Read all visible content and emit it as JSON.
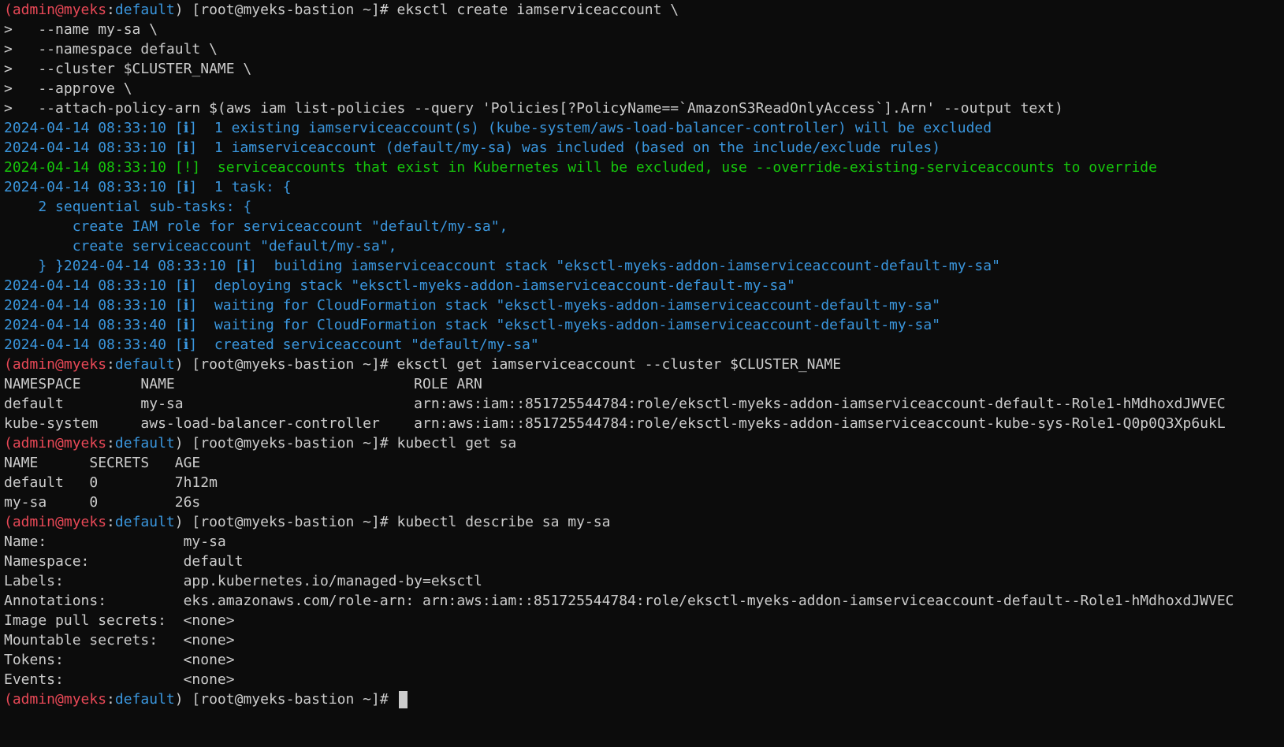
{
  "lines": [
    [
      [
        "red",
        "(admin@myeks"
      ],
      [
        "white",
        ":"
      ],
      [
        "blue",
        "default"
      ],
      [
        "white",
        ") [root@myeks-bastion ~]# eksctl create iamserviceaccount \\"
      ]
    ],
    [
      [
        "white",
        ">   --name my-sa \\"
      ]
    ],
    [
      [
        "white",
        ">   --namespace default \\"
      ]
    ],
    [
      [
        "white",
        ">   --cluster $CLUSTER_NAME \\"
      ]
    ],
    [
      [
        "white",
        ">   --approve \\"
      ]
    ],
    [
      [
        "white",
        ">   --attach-policy-arn $(aws iam list-policies --query 'Policies[?PolicyName==`AmazonS3ReadOnlyAccess`].Arn' --output text)"
      ]
    ],
    [
      [
        "blue",
        "2024-04-14 08:33:10 [ℹ]  1 existing iamserviceaccount(s) (kube-system/aws-load-balancer-controller) will be excluded"
      ]
    ],
    [
      [
        "blue",
        "2024-04-14 08:33:10 [ℹ]  1 iamserviceaccount (default/my-sa) was included (based on the include/exclude rules)"
      ]
    ],
    [
      [
        "green",
        "2024-04-14 08:33:10 [!]  serviceaccounts that exist in Kubernetes will be excluded, use --override-existing-serviceaccounts to override"
      ]
    ],
    [
      [
        "blue",
        "2024-04-14 08:33:10 [ℹ]  1 task: {"
      ]
    ],
    [
      [
        "blue",
        "    2 sequential sub-tasks: {"
      ]
    ],
    [
      [
        "blue",
        "        create IAM role for serviceaccount \"default/my-sa\","
      ]
    ],
    [
      [
        "blue",
        "        create serviceaccount \"default/my-sa\","
      ]
    ],
    [
      [
        "blue",
        "    } }2024-04-14 08:33:10 [ℹ]  building iamserviceaccount stack \"eksctl-myeks-addon-iamserviceaccount-default-my-sa\""
      ]
    ],
    [
      [
        "blue",
        "2024-04-14 08:33:10 [ℹ]  deploying stack \"eksctl-myeks-addon-iamserviceaccount-default-my-sa\""
      ]
    ],
    [
      [
        "blue",
        "2024-04-14 08:33:10 [ℹ]  waiting for CloudFormation stack \"eksctl-myeks-addon-iamserviceaccount-default-my-sa\""
      ]
    ],
    [
      [
        "blue",
        "2024-04-14 08:33:40 [ℹ]  waiting for CloudFormation stack \"eksctl-myeks-addon-iamserviceaccount-default-my-sa\""
      ]
    ],
    [
      [
        "blue",
        "2024-04-14 08:33:40 [ℹ]  created serviceaccount \"default/my-sa\""
      ]
    ],
    [
      [
        "red",
        "(admin@myeks"
      ],
      [
        "white",
        ":"
      ],
      [
        "blue",
        "default"
      ],
      [
        "white",
        ") [root@myeks-bastion ~]# eksctl get iamserviceaccount --cluster $CLUSTER_NAME"
      ]
    ],
    [
      [
        "white",
        "NAMESPACE       NAME                            ROLE ARN"
      ]
    ],
    [
      [
        "white",
        "default         my-sa                           arn:aws:iam::851725544784:role/eksctl-myeks-addon-iamserviceaccount-default--Role1-hMdhoxdJWVEC"
      ]
    ],
    [
      [
        "white",
        "kube-system     aws-load-balancer-controller    arn:aws:iam::851725544784:role/eksctl-myeks-addon-iamserviceaccount-kube-sys-Role1-Q0p0Q3Xp6ukL"
      ]
    ],
    [
      [
        "red",
        "(admin@myeks"
      ],
      [
        "white",
        ":"
      ],
      [
        "blue",
        "default"
      ],
      [
        "white",
        ") [root@myeks-bastion ~]# kubectl get sa"
      ]
    ],
    [
      [
        "white",
        "NAME      SECRETS   AGE"
      ]
    ],
    [
      [
        "white",
        "default   0         7h12m"
      ]
    ],
    [
      [
        "white",
        "my-sa     0         26s"
      ]
    ],
    [
      [
        "red",
        "(admin@myeks"
      ],
      [
        "white",
        ":"
      ],
      [
        "blue",
        "default"
      ],
      [
        "white",
        ") [root@myeks-bastion ~]# kubectl describe sa my-sa"
      ]
    ],
    [
      [
        "white",
        "Name:                my-sa"
      ]
    ],
    [
      [
        "white",
        "Namespace:           default"
      ]
    ],
    [
      [
        "white",
        "Labels:              app.kubernetes.io/managed-by=eksctl"
      ]
    ],
    [
      [
        "white",
        "Annotations:         eks.amazonaws.com/role-arn: arn:aws:iam::851725544784:role/eksctl-myeks-addon-iamserviceaccount-default--Role1-hMdhoxdJWVEC"
      ]
    ],
    [
      [
        "white",
        "Image pull secrets:  <none>"
      ]
    ],
    [
      [
        "white",
        "Mountable secrets:   <none>"
      ]
    ],
    [
      [
        "white",
        "Tokens:              <none>"
      ]
    ],
    [
      [
        "white",
        "Events:              <none>"
      ]
    ],
    [
      [
        "red",
        "(admin@myeks"
      ],
      [
        "white",
        ":"
      ],
      [
        "blue",
        "default"
      ],
      [
        "white",
        ") [root@myeks-bastion ~]# "
      ]
    ]
  ],
  "colors": {
    "background": "#0c0c0c",
    "red": "#e74856",
    "blue": "#3a96dd",
    "green": "#16c60c",
    "white": "#cccccc"
  },
  "cursor": "block-cursor"
}
